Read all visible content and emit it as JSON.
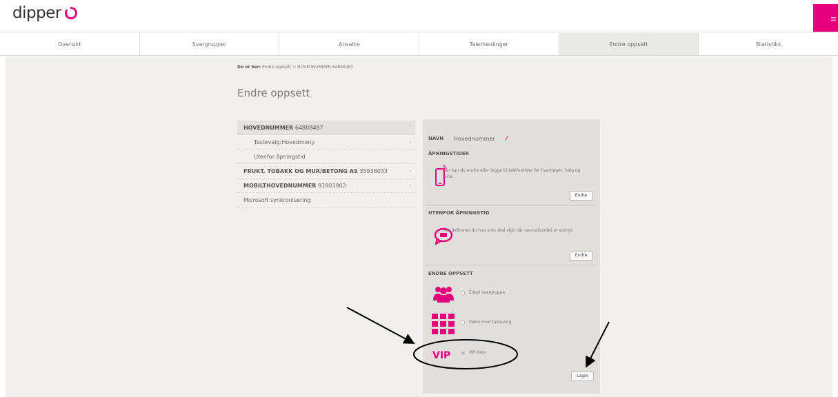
{
  "app": {
    "logo_text": "dipper",
    "menu_icon": "menu-icon"
  },
  "nav": {
    "tabs": [
      {
        "label": "Oversikt"
      },
      {
        "label": "Svargrupper"
      },
      {
        "label": "Ansatte"
      },
      {
        "label": "Talemeldinger"
      },
      {
        "label": "Endre oppsett",
        "active": true
      },
      {
        "label": "Statistikk"
      }
    ]
  },
  "breadcrumb": {
    "prefix": "Du er her:",
    "path": "Endre oppsett > HOVEDNUMMER 64808487"
  },
  "page_title": "Endre oppsett",
  "tree": {
    "main": {
      "name": "HOVEDNUMMER",
      "number": "64808487"
    },
    "sub1": "Tastevalg:Hovedmeny",
    "sub2": "Utenfor åpningstid",
    "frukt": {
      "name": "FRUKT, TOBAKK OG MUR/BETONG AS",
      "number": "35938033"
    },
    "mobil": {
      "name": "MOBILTHOVEDNUMMER",
      "number": "91903902"
    },
    "ms": "Microsoft synkronisering"
  },
  "panel": {
    "navn_label": "NAVN",
    "navn_value": "Hovednummer",
    "apning": {
      "title": "ÅPNINGSTIDER",
      "desc": "Her kan du endre eller legge til telefontider for hverdager, helg og ferie.",
      "button": "Endre"
    },
    "utenfor": {
      "title": "UTENFOR ÅPNINGSTID",
      "desc": "Her definerer du hva som skal skje når sentralbordet er stengt.",
      "button": "Endre"
    },
    "oppsett": {
      "title": "ENDRE OPPSETT",
      "options": [
        {
          "label": "Enkel svargruppe",
          "selected": false
        },
        {
          "label": "Meny med tastevalg",
          "selected": false
        },
        {
          "label": "VIP-liste",
          "selected": true
        }
      ],
      "vip_text": "VIP",
      "save_button": "Lagre"
    }
  },
  "colors": {
    "accent": "#e6007e",
    "background": "#f1f0ec",
    "panel": "#e0dfdb"
  }
}
